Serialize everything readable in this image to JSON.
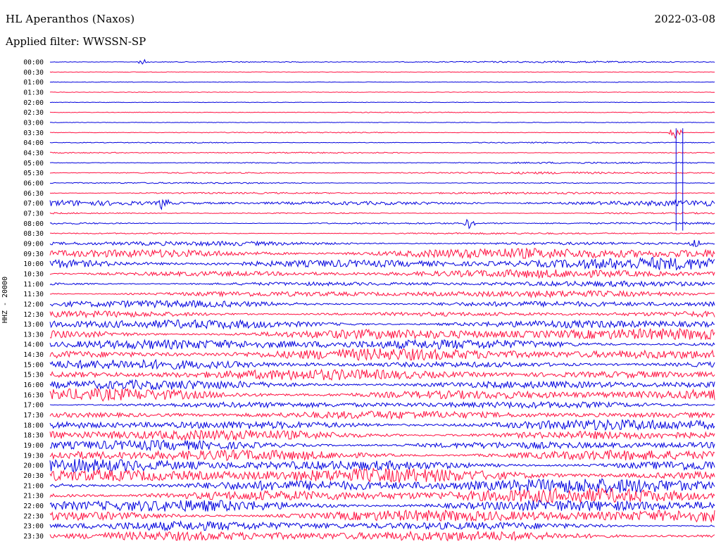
{
  "header": {
    "station": "HL Aperanthos (Naxos)",
    "date": "2022-03-08",
    "filter": "Applied filter: WWSSN-SP"
  },
  "colors": {
    "trace_even": "#0000dd",
    "trace_odd": "#ff1040",
    "background": "#ffffff"
  },
  "chart_data": {
    "type": "line",
    "title": "HL Aperanthos (Naxos)",
    "subtitle": "Applied filter: WWSSN-SP",
    "date": "2022-03-08",
    "ylabel": "HHZ - 20000",
    "xlabel": "",
    "row_labels": [
      "00:00",
      "00:30",
      "01:00",
      "01:30",
      "02:00",
      "02:30",
      "03:00",
      "03:30",
      "04:00",
      "04:30",
      "05:00",
      "05:30",
      "06:00",
      "06:30",
      "07:00",
      "07:30",
      "08:00",
      "08:30",
      "09:00",
      "09:30",
      "10:00",
      "10:30",
      "11:00",
      "11:30",
      "12:00",
      "12:30",
      "13:00",
      "13:30",
      "14:00",
      "14:30",
      "15:00",
      "15:30",
      "16:00",
      "16:30",
      "17:00",
      "17:30",
      "18:00",
      "18:30",
      "19:00",
      "19:30",
      "20:00",
      "20:30",
      "21:00",
      "21:30",
      "22:00",
      "22:30",
      "23:00",
      "23:30"
    ],
    "row_amplitude": [
      1.2,
      0.4,
      0.6,
      0.5,
      0.4,
      0.7,
      0.5,
      0.8,
      1.0,
      1.0,
      1.2,
      1.6,
      1.2,
      1.6,
      4.5,
      1.2,
      1.6,
      1.4,
      3.5,
      9.0,
      9.0,
      6.0,
      4.0,
      5.0,
      6.0,
      5.0,
      8.0,
      9.0,
      8.0,
      9.0,
      7.0,
      8.0,
      8.0,
      10.0,
      5.0,
      6.0,
      9.0,
      9.0,
      8.0,
      10.0,
      10.0,
      11.0,
      11.0,
      11.0,
      11.0,
      10.0,
      7.0,
      8.0
    ],
    "events": [
      {
        "row": "00:00",
        "x_fraction": 0.14,
        "amplitude": 4
      },
      {
        "row": "03:30",
        "x_fraction": 0.94,
        "amplitude": 10
      },
      {
        "row": "07:00",
        "x_fraction": 0.17,
        "amplitude": 12
      },
      {
        "row": "08:00",
        "x_fraction": 0.63,
        "amplitude": 8
      },
      {
        "row": "09:00",
        "x_fraction": 0.97,
        "amplitude": 8
      }
    ],
    "vertical_spikes": [
      {
        "x_fraction": 0.941,
        "from_row": "03:30",
        "to_row": "08:30"
      },
      {
        "x_fraction": 0.951,
        "from_row": "03:30",
        "to_row": "08:30"
      }
    ]
  }
}
